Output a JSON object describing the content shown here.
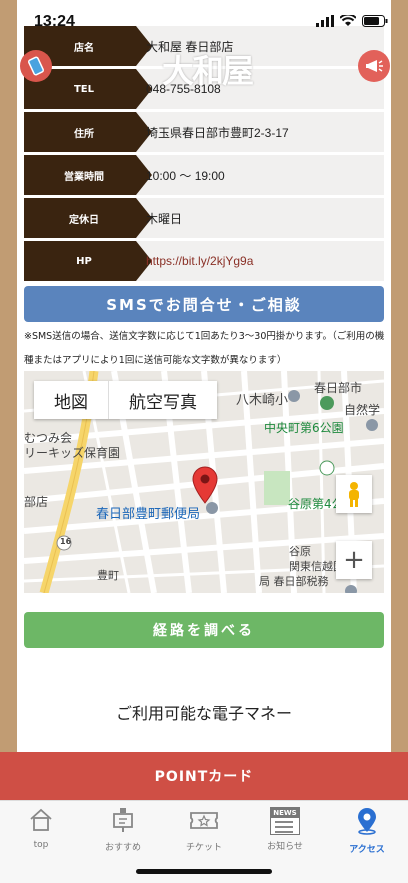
{
  "status": {
    "time": "13:24"
  },
  "header": {
    "logo_text": "大和屋"
  },
  "info_rows": [
    {
      "label": "店名",
      "value": "大和屋 春日部店"
    },
    {
      "label": "TEL",
      "value": "048-755-8108"
    },
    {
      "label": "住所",
      "value": "埼玉県春日部市豊町2-3-17"
    },
    {
      "label": "営業時間",
      "value": "10:00 〜 19:00"
    },
    {
      "label": "定休日",
      "value": "木曜日"
    },
    {
      "label": "HP",
      "value": "https://bit.ly/2kjYg9a"
    }
  ],
  "sms_button": "SMSでお問合せ・ご相談",
  "sms_note": "※SMS送信の場合、送信文字数に応じて1回あたり3〜30円掛かります。（ご利用の機種またはアプリにより1回に送信可能な文字数が異なります）",
  "map": {
    "tabs": [
      "地図",
      "航空写真"
    ],
    "labels": {
      "kasukabe_city": "春日部市",
      "yagizaki": "八木崎小",
      "shizen": "自然学",
      "chuo_park": "中央町第6公園",
      "mutsumi": "むつみ会",
      "kids": "リーキッズ保育園",
      "store": "部店",
      "post_office": "春日部豊町郵便局",
      "yahara4": "谷原第4公",
      "yahara": "谷原",
      "kanto": "関東信越国",
      "tax_office": "局 春日部税務",
      "yutaka": "豊町",
      "route": "16"
    },
    "zoom_in": "+"
  },
  "route_button": "経路を調べる",
  "emoney_title": "ご利用可能な電子マネー",
  "point_card": "POINTカード",
  "tabbar": [
    {
      "label": "top",
      "icon": "home-icon"
    },
    {
      "label": "おすすめ",
      "icon": "signboard-icon"
    },
    {
      "label": "チケット",
      "icon": "ticket-icon"
    },
    {
      "label": "お知らせ",
      "icon": "news-icon",
      "badge": "NEWS"
    },
    {
      "label": "アクセス",
      "icon": "location-pin-icon"
    }
  ],
  "colors": {
    "brand_brown": "#3a2410",
    "sms_blue": "#5a84bd",
    "route_green": "#6db766",
    "point_red": "#cf4f45",
    "active_tab": "#2a6fd1"
  }
}
